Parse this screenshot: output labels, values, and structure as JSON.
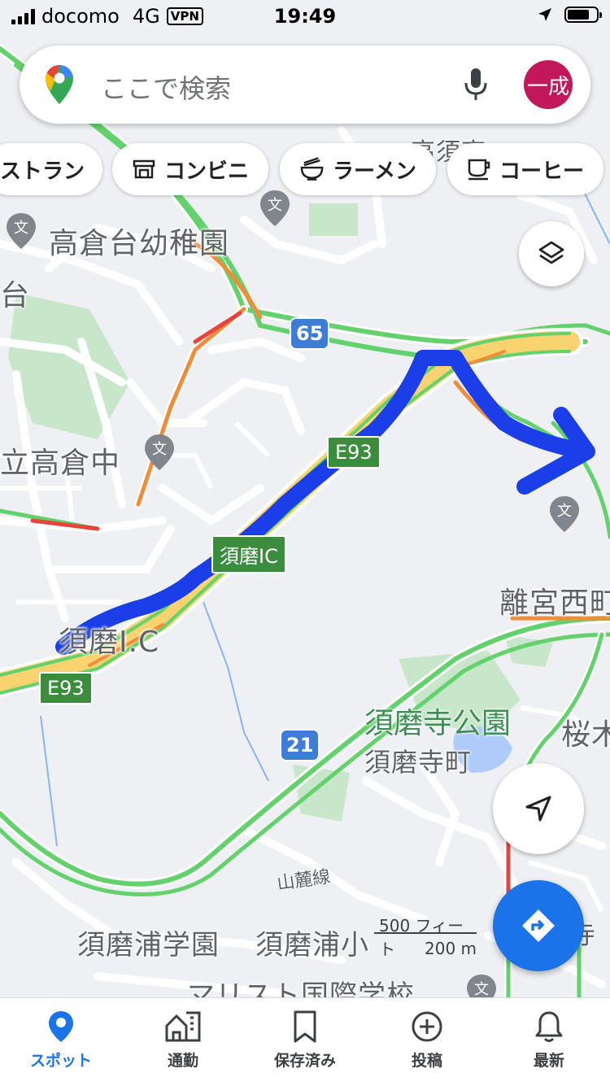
{
  "status_bar": {
    "carrier": "docomo",
    "network": "4G",
    "vpn": "VPN",
    "time": "19:49"
  },
  "search": {
    "placeholder": "ここで検索",
    "avatar_text": "一成"
  },
  "chips": [
    {
      "label": "ストラン",
      "icon": "restaurant-icon"
    },
    {
      "label": "コンビニ",
      "icon": "store-icon"
    },
    {
      "label": "ラーメン",
      "icon": "ramen-icon"
    },
    {
      "label": "コーヒー",
      "icon": "coffee-icon"
    }
  ],
  "map": {
    "labels": {
      "takakuradai_kindergarten": "高倉台幼稚園",
      "dai": "台",
      "takakura_middle": "立高倉中",
      "suma_ic_sign": "須磨IC",
      "suma_ic": "須磨I.C",
      "rikyu_nishi": "離宮西町",
      "sumadera_park": "須磨寺公園",
      "sumadera_town": "須磨寺町",
      "sakura": "桜木",
      "sanroku": "山麓線",
      "sumaura_gakuen": "須磨浦学園",
      "sumaura": "須磨浦小",
      "top_partial": "高須高",
      "bottom_partial": "マリスト国際学校",
      "right_partial": "寺"
    },
    "route_shields": {
      "r65": "65",
      "r21": "21"
    },
    "highway_signs": {
      "e93": "E93",
      "e93_upper": "E93"
    },
    "colors": {
      "highway_fill": "#f9d36f",
      "traffic_green": "#63d26c",
      "traffic_orange": "#f28c38",
      "traffic_red": "#e8443b",
      "route_drawn": "#1a3fe8",
      "park": "#c8e6c9"
    }
  },
  "scale": {
    "feet": "500 フィート",
    "meters": "200 m"
  },
  "bottom_nav": [
    {
      "label": "スポット",
      "icon": "pin-icon",
      "active": true
    },
    {
      "label": "通勤",
      "icon": "commute-icon",
      "active": false
    },
    {
      "label": "保存済み",
      "icon": "bookmark-icon",
      "active": false
    },
    {
      "label": "投稿",
      "icon": "add-circle-icon",
      "active": false
    },
    {
      "label": "最新",
      "icon": "bell-icon",
      "active": false
    }
  ]
}
